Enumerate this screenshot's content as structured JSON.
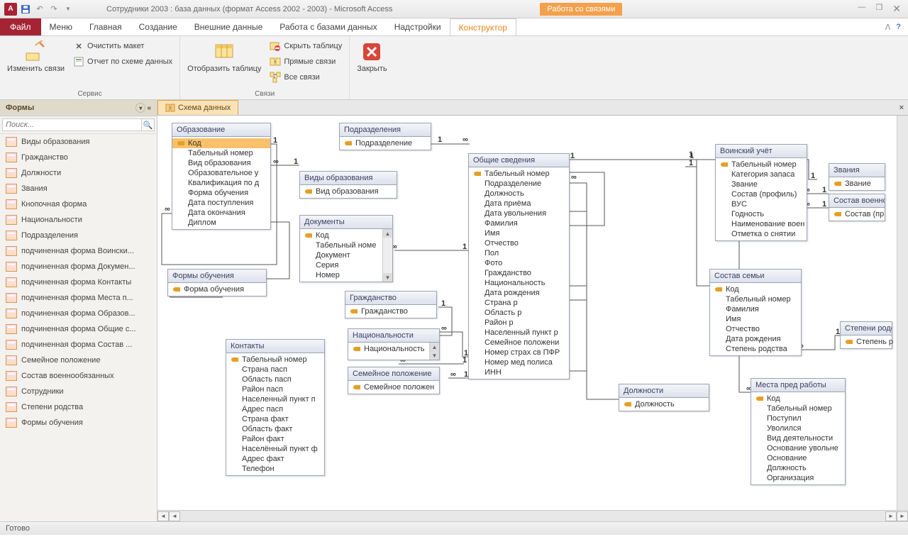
{
  "title": "Сотрудники 2003 : база данных (формат Access 2002 - 2003)  -  Microsoft Access",
  "context_tab_group": "Работа со связями",
  "menu": {
    "file": "Файл",
    "items": [
      "Меню",
      "Главная",
      "Создание",
      "Внешние данные",
      "Работа с базами данных",
      "Надстройки",
      "Конструктор"
    ]
  },
  "ribbon": {
    "g1": {
      "edit": "Изменить связи",
      "clear": "Очистить макет",
      "report": "Отчет по схеме данных",
      "title": "Сервис"
    },
    "g2": {
      "show": "Отобразить таблицу",
      "hide": "Скрыть таблицу",
      "direct": "Прямые связи",
      "all": "Все связи",
      "title": "Связи"
    },
    "g3": {
      "close": "Закрыть"
    }
  },
  "nav": {
    "header": "Формы",
    "search_placeholder": "Поиск...",
    "items": [
      "Виды образования",
      "Гражданство",
      "Должности",
      "Звания",
      "Кнопочная форма",
      "Национальности",
      "Подразделения",
      "подчиненная форма Воински...",
      "подчиненная форма Докумен...",
      "подчиненная форма Контакты",
      "подчиненная форма Места п...",
      "подчиненная форма Образов...",
      "подчиненная форма Общие с...",
      "подчиненная форма Состав ...",
      "Семейное положение",
      "Состав военнообязанных",
      "Сотрудники",
      "Степени родства",
      "Формы обучения"
    ]
  },
  "doc_tab": "Схема данных",
  "tables": {
    "obrazovanie": {
      "title": "Образование",
      "fields": [
        {
          "n": "Код",
          "pk": true,
          "sel": true
        },
        {
          "n": "Табельный номер"
        },
        {
          "n": "Вид образования"
        },
        {
          "n": "Образовательное у"
        },
        {
          "n": "Квалификация по д"
        },
        {
          "n": "Форма обучения"
        },
        {
          "n": "Дата поступления"
        },
        {
          "n": "Дата окончания"
        },
        {
          "n": "Диплом"
        }
      ]
    },
    "formy": {
      "title": "Формы обучения",
      "fields": [
        {
          "n": "Форма обучения",
          "pk": true
        }
      ]
    },
    "kontakty": {
      "title": "Контакты",
      "fields": [
        {
          "n": "Табельный номер",
          "pk": true
        },
        {
          "n": "Страна пасп"
        },
        {
          "n": "Область пасп"
        },
        {
          "n": "Район пасп"
        },
        {
          "n": "Населенный пункт п"
        },
        {
          "n": "Адрес пасп"
        },
        {
          "n": "Страна факт"
        },
        {
          "n": "Область факт"
        },
        {
          "n": "Район факт"
        },
        {
          "n": "Населённый пункт ф"
        },
        {
          "n": "Адрес факт"
        },
        {
          "n": "Телефон"
        }
      ]
    },
    "podrazd": {
      "title": "Подразделения",
      "fields": [
        {
          "n": "Подразделение",
          "pk": true
        }
      ]
    },
    "vidy": {
      "title": "Виды образования",
      "fields": [
        {
          "n": "Вид образования",
          "pk": true
        }
      ]
    },
    "docs": {
      "title": "Документы",
      "fields": [
        {
          "n": "Код",
          "pk": true
        },
        {
          "n": "Табельный номе"
        },
        {
          "n": "Документ"
        },
        {
          "n": "Серия"
        },
        {
          "n": "Номер"
        }
      ]
    },
    "grazh": {
      "title": "Гражданство",
      "fields": [
        {
          "n": "Гражданство",
          "pk": true
        }
      ]
    },
    "nation": {
      "title": "Национальности",
      "fields": [
        {
          "n": "Национальность",
          "pk": true
        }
      ]
    },
    "semeinoe": {
      "title": "Семейное положение",
      "fields": [
        {
          "n": "Семейное положен",
          "pk": true
        }
      ]
    },
    "obshie": {
      "title": "Общие сведения",
      "fields": [
        {
          "n": "Табельный номер",
          "pk": true
        },
        {
          "n": "Подразделение"
        },
        {
          "n": "Должность"
        },
        {
          "n": "Дата приёма"
        },
        {
          "n": "Дата увольнения"
        },
        {
          "n": "Фамилия"
        },
        {
          "n": "Имя"
        },
        {
          "n": "Отчество"
        },
        {
          "n": "Пол"
        },
        {
          "n": "Фото"
        },
        {
          "n": "Гражданство"
        },
        {
          "n": "Национальность"
        },
        {
          "n": "Дата рождения"
        },
        {
          "n": "Страна р"
        },
        {
          "n": "Область р"
        },
        {
          "n": "Район р"
        },
        {
          "n": "Населенный пункт р"
        },
        {
          "n": "Семейное положени"
        },
        {
          "n": "Номер страх св ПФР"
        },
        {
          "n": "Номер мед полиса"
        },
        {
          "n": "ИНН"
        }
      ]
    },
    "dolzh": {
      "title": "Должности",
      "fields": [
        {
          "n": "Должность",
          "pk": true
        }
      ]
    },
    "voin": {
      "title": "Воинский учёт",
      "fields": [
        {
          "n": "Табельный номер",
          "pk": true
        },
        {
          "n": "Категория запаса"
        },
        {
          "n": "Звание"
        },
        {
          "n": "Состав (профиль)"
        },
        {
          "n": "ВУС"
        },
        {
          "n": "Годность"
        },
        {
          "n": "Наименование воен"
        },
        {
          "n": "Отметка о снятии"
        }
      ]
    },
    "zvan": {
      "title": "Звания",
      "fields": [
        {
          "n": "Звание",
          "pk": true
        }
      ]
    },
    "sostavv": {
      "title": "Состав военно",
      "fields": [
        {
          "n": "Состав (пр",
          "pk": true
        }
      ]
    },
    "sostavs": {
      "title": "Состав семьи",
      "fields": [
        {
          "n": "Код",
          "pk": true
        },
        {
          "n": "Табельный номер"
        },
        {
          "n": "Фамилия"
        },
        {
          "n": "Имя"
        },
        {
          "n": "Отчество"
        },
        {
          "n": "Дата рождения"
        },
        {
          "n": "Степень родства"
        }
      ]
    },
    "stepen": {
      "title": "Степени родст",
      "fields": [
        {
          "n": "Степень р",
          "pk": true
        }
      ]
    },
    "mesta": {
      "title": "Места пред работы",
      "fields": [
        {
          "n": "Код",
          "pk": true
        },
        {
          "n": "Табельный номер"
        },
        {
          "n": "Поступил"
        },
        {
          "n": "Уволился"
        },
        {
          "n": "Вид деятельности"
        },
        {
          "n": "Основание увольне"
        },
        {
          "n": "Основание"
        },
        {
          "n": "Должность"
        },
        {
          "n": "Организация"
        }
      ]
    }
  },
  "status": "Готово"
}
